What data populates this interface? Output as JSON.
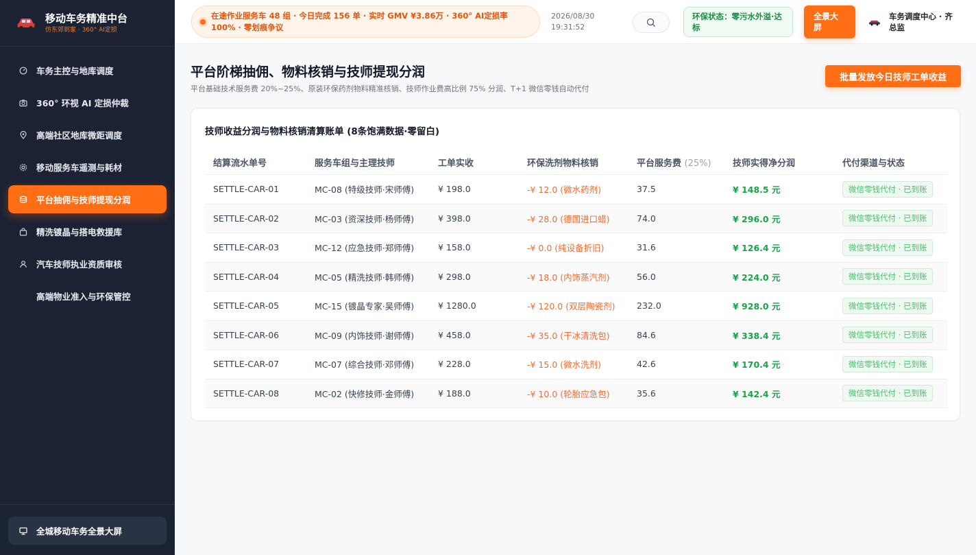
{
  "app": {
    "title": "移动车务精准中台",
    "subtitle": "仿东郊到家 · 360° AI定损"
  },
  "sidebar": {
    "items": [
      {
        "label": "车务主控与地库调度",
        "icon": "gauge-icon"
      },
      {
        "label": "360° 环视 AI 定损仲裁",
        "icon": "camera-icon"
      },
      {
        "label": "高端社区地库微距调度",
        "icon": "map-pin-icon"
      },
      {
        "label": "移动服务车遥测与耗材",
        "icon": "gear-icon"
      },
      {
        "label": "平台抽佣与技师提现分润",
        "icon": "database-icon",
        "active": true
      },
      {
        "label": "精洗镀晶与搭电救援库",
        "icon": "bag-icon"
      },
      {
        "label": "汽车技师执业资质审核",
        "icon": "user-icon"
      },
      {
        "label": "高端物业准入与环保管控",
        "icon": ""
      }
    ],
    "footer_label": "全城移动车务全景大屏"
  },
  "header": {
    "ticker": "在途作业服务车 48 组 · 今日完成 156 单 · 实时 GMV ¥3.86万 · 360° AI定损率 100% · 零划痕争议",
    "date": "2026/08/30",
    "time": "19:31:52",
    "env_status": "环保状态：零污水外溢·达标",
    "fullscreen_label": "全景大屏",
    "user_name": "车务调度中心 · 齐总监"
  },
  "page": {
    "title": "平台阶梯抽佣、物料核销与技师提现分润",
    "subtitle": "平台基础技术服务费 20%~25%、原装环保药剂物料精准核销、技师作业费高比例 75% 分润、T+1 微信零钱自动代付",
    "batch_button": "批量发放今日技师工单收益"
  },
  "ledger": {
    "title": "技师收益分润与物料核销清算账单 (8条饱满数据·零留白)",
    "columns": {
      "id": "结算流水单号",
      "team": "服务车组与主理技师",
      "paid": "工单实收",
      "material": "环保洗剂物料核销",
      "fee": "平台服务费",
      "fee_note": "(25%)",
      "net": "技师实得净分润",
      "channel": "代付渠道与状态"
    },
    "rows": [
      {
        "id": "SETTLE-CAR-01",
        "team": "MC-08 (特级技师·宋师傅)",
        "paid": "¥ 198.0",
        "material": "-¥ 12.0 (微水药剂)",
        "fee": "37.5",
        "net": "¥ 148.5 元",
        "channel": "微信零钱代付 · 已到账"
      },
      {
        "id": "SETTLE-CAR-02",
        "team": "MC-03 (资深技师·杨师傅)",
        "paid": "¥ 398.0",
        "material": "-¥ 28.0 (德国进口蜡)",
        "fee": "74.0",
        "net": "¥ 296.0 元",
        "channel": "微信零钱代付 · 已到账"
      },
      {
        "id": "SETTLE-CAR-03",
        "team": "MC-12 (应急技师·郑师傅)",
        "paid": "¥ 158.0",
        "material": "-¥ 0.0 (纯设备折旧)",
        "fee": "31.6",
        "net": "¥ 126.4 元",
        "channel": "微信零钱代付 · 已到账"
      },
      {
        "id": "SETTLE-CAR-04",
        "team": "MC-05 (精洗技师·韩师傅)",
        "paid": "¥ 298.0",
        "material": "-¥ 18.0 (内饰蒸汽剂)",
        "fee": "56.0",
        "net": "¥ 224.0 元",
        "channel": "微信零钱代付 · 已到账"
      },
      {
        "id": "SETTLE-CAR-05",
        "team": "MC-15 (镀晶专家·吴师傅)",
        "paid": "¥ 1280.0",
        "material": "-¥ 120.0 (双层陶瓷剂)",
        "fee": "232.0",
        "net": "¥ 928.0 元",
        "channel": "微信零钱代付 · 已到账"
      },
      {
        "id": "SETTLE-CAR-06",
        "team": "MC-09 (内饰技师·谢师傅)",
        "paid": "¥ 458.0",
        "material": "-¥ 35.0 (干冰清洗包)",
        "fee": "84.6",
        "net": "¥ 338.4 元",
        "channel": "微信零钱代付 · 已到账"
      },
      {
        "id": "SETTLE-CAR-07",
        "team": "MC-07 (综合技师·邓师傅)",
        "paid": "¥ 228.0",
        "material": "-¥ 15.0 (微水洗剂)",
        "fee": "42.6",
        "net": "¥ 170.4 元",
        "channel": "微信零钱代付 · 已到账"
      },
      {
        "id": "SETTLE-CAR-08",
        "team": "MC-02 (快修技师·金师傅)",
        "paid": "¥ 188.0",
        "material": "-¥ 10.0 (轮胎应急包)",
        "fee": "35.6",
        "net": "¥ 142.4 元",
        "channel": "微信零钱代付 · 已到账"
      }
    ]
  },
  "colors": {
    "accent": "#ff6d14",
    "sidebar_bg": "#1b2233",
    "success": "#16a34a"
  }
}
